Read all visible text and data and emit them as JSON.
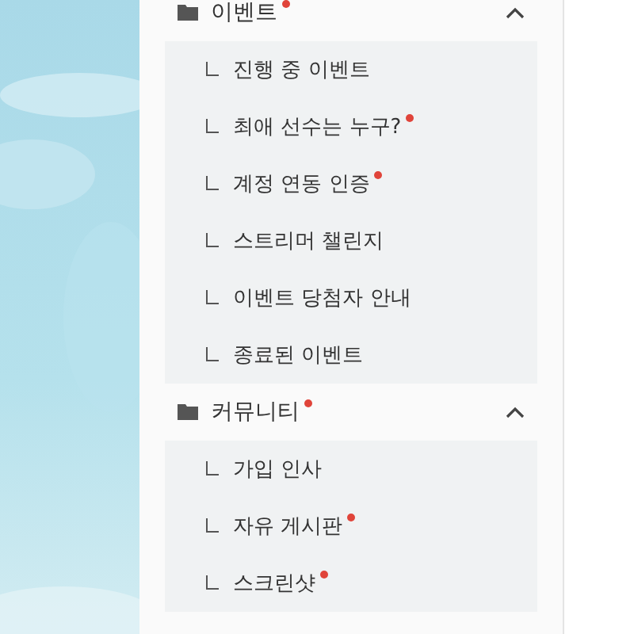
{
  "menu": [
    {
      "label": "이벤트",
      "new": true,
      "expanded": true,
      "children": [
        {
          "label": "진행 중 이벤트",
          "new": false
        },
        {
          "label": "최애 선수는 누구?",
          "new": true
        },
        {
          "label": "계정 연동 인증",
          "new": true
        },
        {
          "label": "스트리머 챌린지",
          "new": false
        },
        {
          "label": "이벤트 당첨자 안내",
          "new": false
        },
        {
          "label": "종료된 이벤트",
          "new": false
        }
      ]
    },
    {
      "label": "커뮤니티",
      "new": true,
      "expanded": true,
      "children": [
        {
          "label": "가입 인사",
          "new": false
        },
        {
          "label": "자유 게시판",
          "new": true
        },
        {
          "label": "스크린샷",
          "new": true
        }
      ]
    }
  ]
}
